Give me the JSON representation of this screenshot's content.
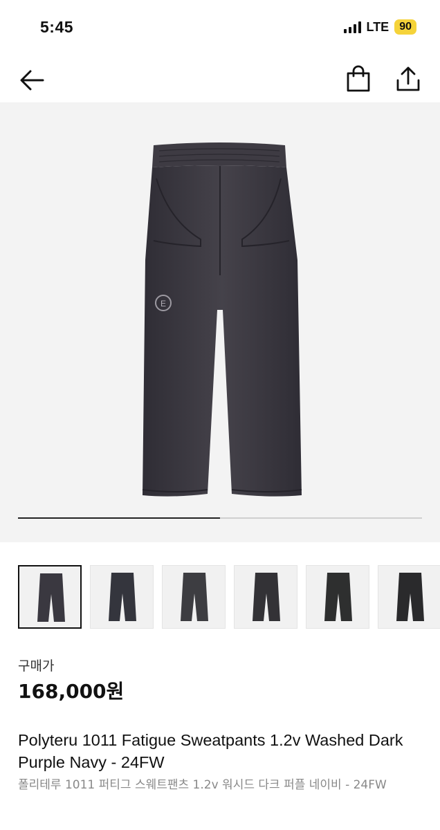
{
  "status_bar": {
    "time": "5:45",
    "network": "LTE",
    "battery": "90"
  },
  "nav": {
    "back_icon": "arrow-left-icon",
    "bag_icon": "shopping-bag-icon",
    "share_icon": "share-icon"
  },
  "gallery": {
    "progress": 0.5,
    "thumbnail_count": 6,
    "selected_index": 0
  },
  "price": {
    "label": "구매가",
    "value": "168,000원"
  },
  "product": {
    "title": "Polyteru 1011 Fatigue Sweatpants 1.2v Washed Dark Purple Navy - 24FW",
    "subtitle": "폴리테루 1011 퍼티그 스웨트팬츠 1.2v 워시드 다크 퍼플 네이비 - 24FW"
  },
  "colors": {
    "pants": "#3a3840",
    "background": "#f3f3f3",
    "battery": "#f5d33a"
  }
}
